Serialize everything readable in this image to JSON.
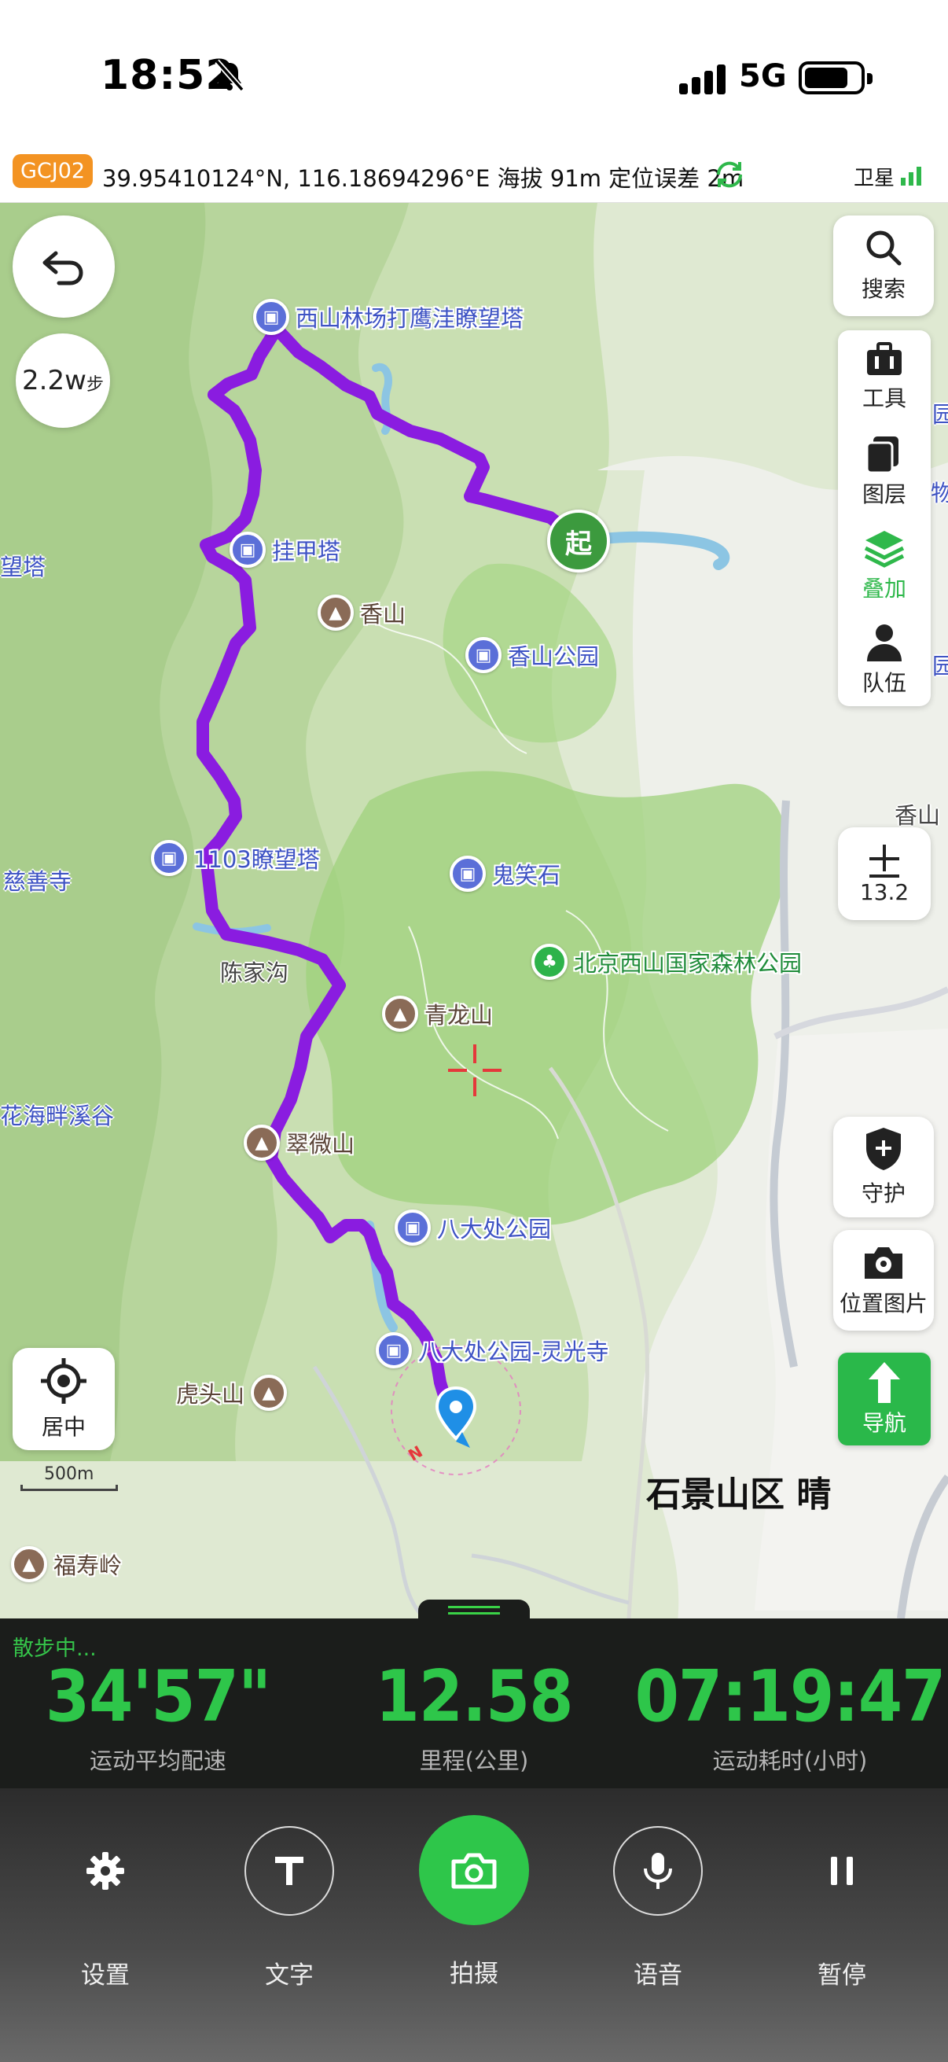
{
  "status": {
    "time": "18:52",
    "network": "5G"
  },
  "location": {
    "coord_system": "GCJ02",
    "info": "39.95410124°N, 116.18694296°E 海拔 91m  定位误差  2m",
    "satellite_label": "卫星"
  },
  "map": {
    "steps": "2.2w",
    "steps_unit": "步",
    "start_marker": "起",
    "pois": {
      "tower1": "西山林场打鹰洼瞭望塔",
      "guajia": "挂甲塔",
      "xiangshan": "香山",
      "xiangshan_park": "香山公园",
      "tower1103": "1103瞭望塔",
      "guixiao": "鬼笑石",
      "forest_park": "北京西山国家森林公园",
      "qinglong": "青龙山",
      "cuiwei": "翠微山",
      "badachu": "八大处公园",
      "lingguang": "八大处公园-灵光寺",
      "hutou": "虎头山",
      "fushou": "福寿岭"
    },
    "labels": {
      "left_tower": "望塔",
      "cishan": "慈善寺",
      "chenjiagou": "陈家沟",
      "huahai": "花海畔溪谷",
      "xiangshan_right": "香山",
      "right_edge1": "园",
      "right_edge2": "物",
      "right_edge3": "园"
    },
    "zoom": "13.2",
    "scale": "500m",
    "weather": "石景山区 晴",
    "compass": "N",
    "controls": {
      "search": "搜索",
      "tools": "工具",
      "layers": "图层",
      "overlay": "叠加",
      "team": "队伍",
      "guard": "守护",
      "location_photo": "位置图片",
      "navigate": "导航",
      "center": "居中"
    }
  },
  "stats": {
    "status": "散步中...",
    "pace": "34'57\"",
    "pace_label": "运动平均配速",
    "distance": "12.58",
    "distance_label": "里程(公里)",
    "duration": "07:19:47",
    "duration_label": "运动耗时(小时)"
  },
  "actions": {
    "settings": "设置",
    "text": "文字",
    "shoot": "拍摄",
    "voice": "语音",
    "pause": "暂停"
  }
}
